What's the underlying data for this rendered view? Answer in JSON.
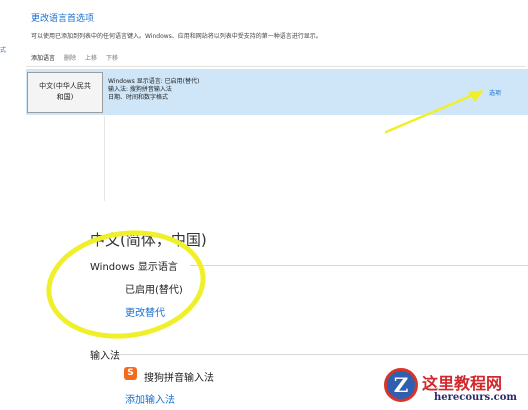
{
  "header": {
    "title": "更改语言首选项",
    "description": "可以使用已添加到列表中的任何语言键入。Windows、应用和网站将以列表中受支持的第一种语言进行显示。",
    "left_edge": "式"
  },
  "toolbar": {
    "add_label": "添加语言",
    "remove_label": "删除",
    "up_label": "上移",
    "down_label": "下移"
  },
  "language_row": {
    "tile_line1": "中文(中华人民共",
    "tile_line2": "和国)",
    "info_line1": "Windows 显示语言: 已启用(替代)",
    "info_line2": "输入法: 搜狗拼音输入法",
    "info_line3": "日期、时间和数字格式",
    "options_label": "选项"
  },
  "detail": {
    "language_heading": "中文(简体，中国)",
    "display_section": "Windows 显示语言",
    "enabled_status": "已启用(替代)",
    "change_override_link": "更改替代",
    "input_section": "输入法",
    "ime_name": "搜狗拼音输入法",
    "add_ime_link": "添加输入法"
  },
  "watermark": {
    "title": "这里教程网",
    "url": "herecours.com",
    "logo_letter": "Z"
  },
  "colors": {
    "accent_blue": "#1a6fd1",
    "row_highlight": "#cfe6f8",
    "annotation_yellow": "#f0f02a"
  },
  "icons": {
    "ime": "sogou-s-icon"
  }
}
